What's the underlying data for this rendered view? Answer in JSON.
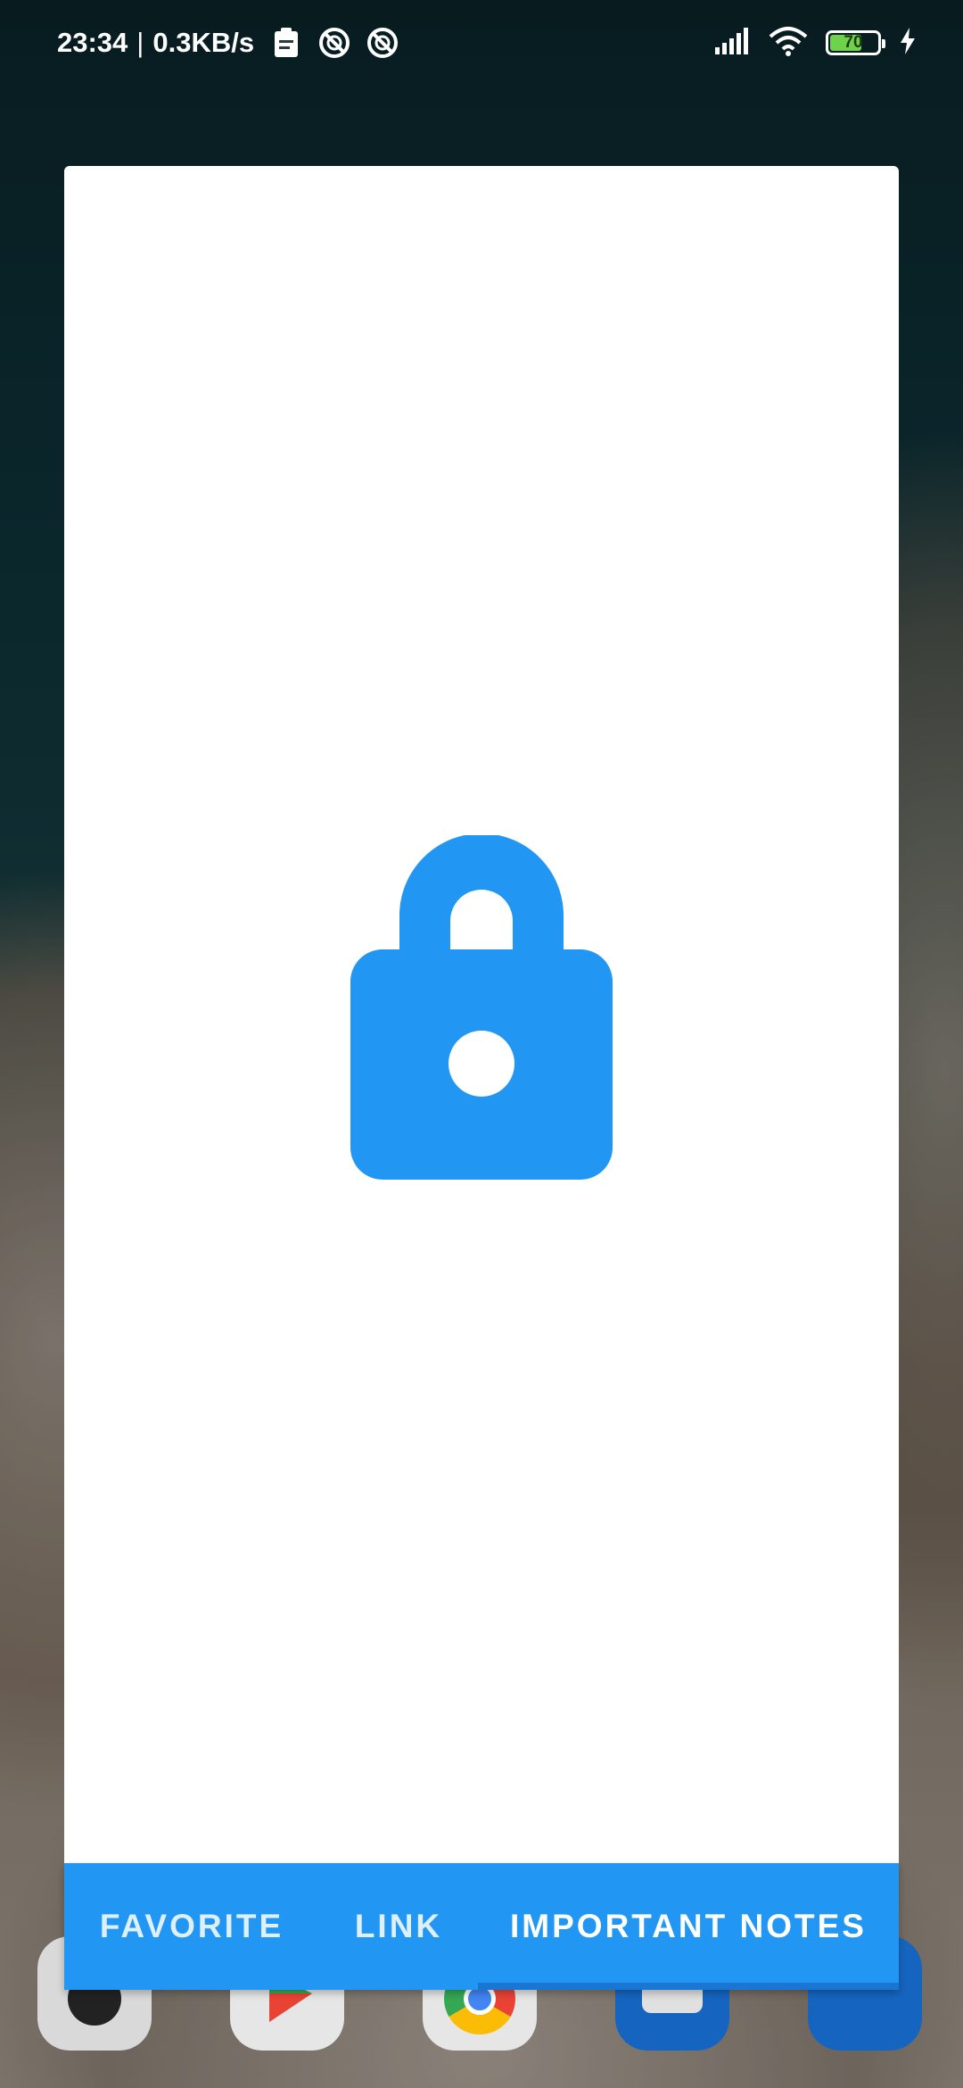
{
  "status_bar": {
    "time": "23:34",
    "separator": "|",
    "network_speed": "0.3KB/s",
    "battery_level": "70",
    "battery_fraction": 0.7,
    "icons": [
      "clipboard-icon",
      "no-disturb-icon",
      "no-disturb-icon",
      "signal-icon",
      "wifi-icon",
      "battery-icon",
      "charging-icon"
    ]
  },
  "colors": {
    "accent": "#2196f3",
    "indicator": "#1976d2",
    "battery_fill": "#6fd24b",
    "card": "#ffffff"
  },
  "main": {
    "icon": "lock-icon"
  },
  "tabs": [
    {
      "label": "FAVORITE",
      "selected": false
    },
    {
      "label": "LINK",
      "selected": false
    },
    {
      "label": "IMPORTANT NOTES",
      "selected": true
    }
  ]
}
